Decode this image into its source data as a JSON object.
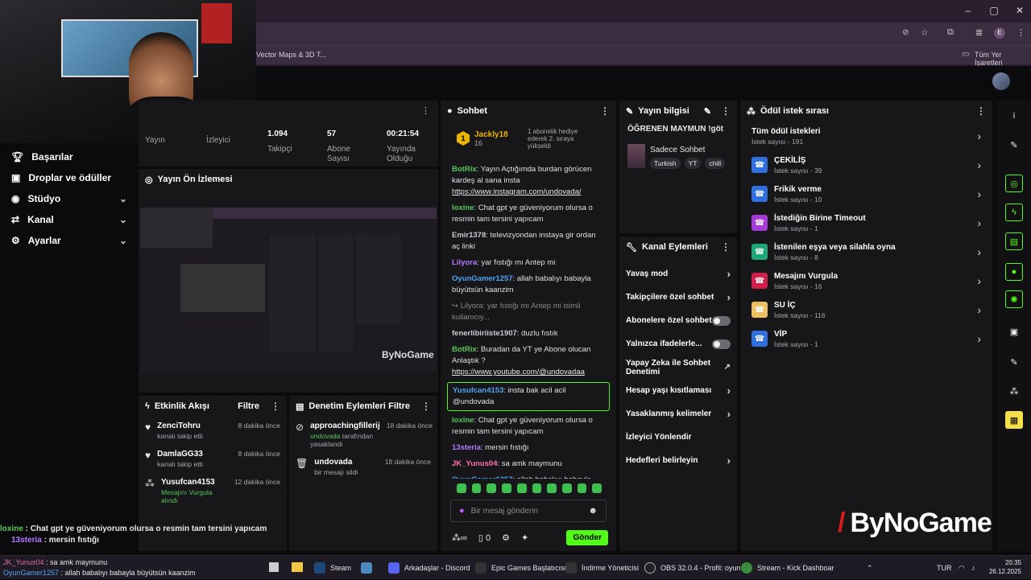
{
  "browser": {
    "bookmark_left": "Vector Maps & 3D T...",
    "bookmark_right": "Tüm Yer İşaretleri",
    "profile_letter": "E"
  },
  "sidebar": {
    "items": [
      {
        "label": "Başarılar",
        "icon": "trophy-icon",
        "chevron": false
      },
      {
        "label": "Droplar ve ödüller",
        "icon": "gift-icon",
        "chevron": false
      },
      {
        "label": "Stüdyo",
        "icon": "camera-icon",
        "chevron": true
      },
      {
        "label": "Kanal",
        "icon": "broadcast-icon",
        "chevron": true
      },
      {
        "label": "Ayarlar",
        "icon": "gear-icon",
        "chevron": true
      }
    ]
  },
  "stats": {
    "items": [
      {
        "value": "",
        "label": "Yayın"
      },
      {
        "value": "",
        "label": "İzleyici"
      },
      {
        "value": "1.094",
        "label": "Takipçi"
      },
      {
        "value": "57",
        "label": "Abone Sayısı"
      },
      {
        "value": "00:21:54",
        "label": "Yayında Olduğu"
      }
    ]
  },
  "preview": {
    "title": "Yayın Ön İzlemesi"
  },
  "activity": {
    "title": "Etkinlik Akışı",
    "filter": "Filtre",
    "items": [
      {
        "name": "ZenciTohru",
        "sub": "kanalı takip etti",
        "time": "8 dakika önce",
        "icon": "heart-icon"
      },
      {
        "name": "DamlaGG33",
        "sub": "kanalı takip etti",
        "time": "8 dakika önce",
        "icon": "heart-icon"
      },
      {
        "name": "Yusufcan4153",
        "sub": "Mesajını Vurgula alındı",
        "time": "12 dakika önce",
        "icon": "nodes-icon"
      }
    ]
  },
  "moderation": {
    "title": "Denetim Eylemleri",
    "filter": "Filtre",
    "items": [
      {
        "name": "approachingfillerij",
        "sub_user": "undovada",
        "sub": "tarafından yasaklandı",
        "time": "18 dakika önce",
        "icon": "ban-icon"
      },
      {
        "name": "undovada",
        "sub_user": "",
        "sub": "bir mesajı sildi",
        "time": "18 dakika önce",
        "icon": "trash-icon"
      }
    ]
  },
  "chat": {
    "title": "Sohbet",
    "pinned": {
      "user": "Jackly18",
      "count": "16",
      "badge_num": "1",
      "text": "1 abonelik hediye ederek 2. sıraya yükseldi"
    },
    "messages": [
      {
        "user": "BotRix",
        "cls": "u-green",
        "text": ": Yayın Açtığımda burdan görücen kardeş al sana insta",
        "link": "https://www.instagram.com/undovada/"
      },
      {
        "user": "loxine",
        "cls": "u-green",
        "text": ": Chat gpt ye güveniyorum olursa o resmin tam tersini yapıcam",
        "link": ""
      },
      {
        "user": "Emir1378",
        "cls": "u-gray",
        "text": ": televizyondan instaya gir ordan aç linki",
        "link": ""
      },
      {
        "user": "Lilyora",
        "cls": "u-purple",
        "text": ": yar fıstığı mı Antep mi",
        "link": ""
      },
      {
        "user": "OyunGamer1257",
        "cls": "u-blue",
        "text": ": allah babalıyı babayla büyütsün kaanzim",
        "link": ""
      },
      {
        "user": "",
        "cls": "u-gray",
        "text": "↪ Lilyora: yar fıstığı mı Antep mi isimli kullanıcıy...",
        "link": ""
      },
      {
        "user": "fenerlibiriiste1907",
        "cls": "u-gray",
        "text": ": duzlu fıstık",
        "link": ""
      },
      {
        "user": "BotRix",
        "cls": "u-green",
        "text": ": Buradan da YT ye Abone olucan Anlaştık ?",
        "link": "https://www.youtube.com/@undovadaa"
      },
      {
        "user": "Yusufcan4153",
        "cls": "u-blue",
        "text": ": insta bak acil acil @undovada",
        "link": "",
        "highlight": true
      },
      {
        "user": "loxine",
        "cls": "u-green",
        "text": ": Chat gpt ye güveniyorum olursa o resmin tam tersini yapıcam",
        "link": ""
      },
      {
        "user": "13steria",
        "cls": "u-purple",
        "text": ": mersin fıstığı",
        "link": ""
      },
      {
        "user": "JK_Yunus04",
        "cls": "u-pink",
        "text": ": sa amk maymunu",
        "link": ""
      },
      {
        "user": "OyunGamer1257",
        "cls": "u-blue",
        "text": ": allah babalıyı babayla büyütsün kaanzim",
        "link": ""
      }
    ],
    "input_placeholder": "Bir mesaj gönderin",
    "count": "0",
    "send": "Gönder"
  },
  "stream_info": {
    "title": "Yayın bilgisi",
    "stream_title": "ÖĞRENEN MAYMUN !göt",
    "category": "Sadece Sohbet",
    "tags": [
      "Turkish",
      "YT",
      "chill"
    ]
  },
  "channel_actions": {
    "title": "Kanal Eylemleri",
    "items": [
      {
        "label": "Yavaş mod",
        "kind": "chevron"
      },
      {
        "label": "Takipçilere özel sohbet",
        "kind": "chevron"
      },
      {
        "label": "Abonelere özel sohbet",
        "kind": "toggle"
      },
      {
        "label": "Yalnızca ifadelerle...",
        "kind": "toggle"
      },
      {
        "label": "Yapay Zeka ile Sohbet Denetimi",
        "kind": "external"
      },
      {
        "label": "Hesap yaşı kısıtlaması",
        "kind": "chevron"
      },
      {
        "label": "Yasaklanmış kelimeler",
        "kind": "chevron"
      },
      {
        "label": "İzleyici Yönlendir",
        "kind": "none"
      },
      {
        "label": "Hedefleri belirleyin",
        "kind": "chevron"
      }
    ]
  },
  "rewards": {
    "title": "Ödül istek sırası",
    "all_title": "Tüm ödül istekleri",
    "all_sub": "İstek sayısı - 191",
    "items": [
      {
        "title": "ÇEKİLİŞ",
        "sub": "İstek sayısı - 39",
        "color": "#2f6fe0"
      },
      {
        "title": "Frikik verme",
        "sub": "İstek sayısı - 10",
        "color": "#2f6fe0"
      },
      {
        "title": "İstediğin Birine Timeout",
        "sub": "İstek sayısı - 1",
        "color": "#a53ad6"
      },
      {
        "title": "İstenilen eşya veya silahla oyna",
        "sub": "İstek sayısı - 8",
        "color": "#1ea87a"
      },
      {
        "title": "Mesajını Vurgula",
        "sub": "İstek sayısı - 16",
        "color": "#d0204a"
      },
      {
        "title": "SU İÇ",
        "sub": "İstek sayısı - 116",
        "color": "#f0c060"
      },
      {
        "title": "VİP",
        "sub": "İstek sayısı - 1",
        "color": "#2f6fe0"
      }
    ]
  },
  "overlay_chat": [
    {
      "user": "loxine",
      "text": " : Chat gpt ye güveniyorum olursa o resmin tam tersini yapıcam"
    },
    {
      "user": "13steria",
      "text": " : mersin fıstığı"
    },
    {
      "user": "JK_Yunus04",
      "text": " : sa amk maymunu"
    },
    {
      "user": "OyunGamer1257",
      "text": " : allah babalıyı babayla büyütsün kaanzim"
    }
  ],
  "watermark": "ByNoGame",
  "taskbar": {
    "items": [
      "Steam",
      "Arkadaşlar - Discord",
      "Epic Games Başlatıcısı",
      "İndirme Yöneticisi",
      "OBS 32.0.4 - Profil: oyun",
      "Stream - Kick Dashboar"
    ],
    "lang": "TUR",
    "time": "20:35",
    "date": "26.12.2025"
  },
  "colors": {
    "accent": "#53fc18",
    "panel": "#17171a",
    "background": "#0b0b0d"
  }
}
